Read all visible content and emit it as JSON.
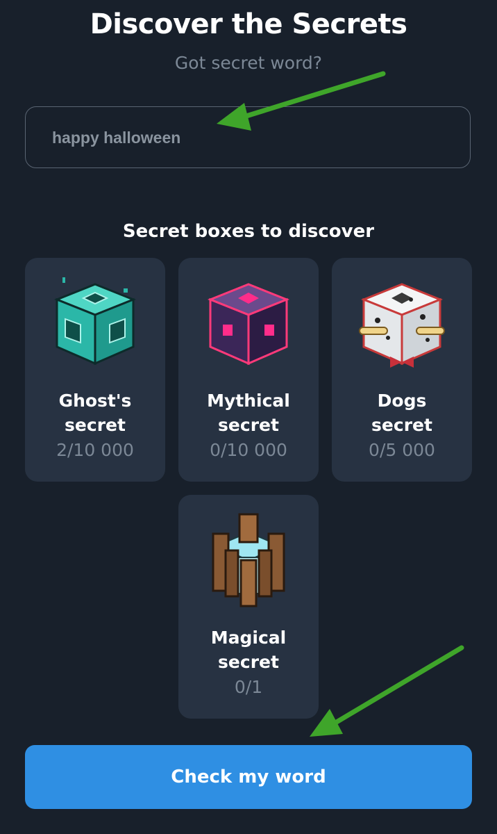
{
  "header": {
    "title": "Discover the Secrets",
    "subtitle": "Got secret word?"
  },
  "secret_input": {
    "value": "happy halloween"
  },
  "section": {
    "title": "Secret boxes to discover"
  },
  "boxes": [
    {
      "name": "Ghost's secret",
      "count": "2/10 000",
      "icon": "ghost-cube-icon",
      "color": "#2bb7a8"
    },
    {
      "name": "Mythical secret",
      "count": "0/10 000",
      "icon": "mythical-cube-icon",
      "color": "#4a2d6b"
    },
    {
      "name": "Dogs secret",
      "count": "0/5 000",
      "icon": "dog-cube-icon",
      "color": "#e9ecef"
    },
    {
      "name": "Magical secret",
      "count": "0/1",
      "icon": "magical-cube-icon",
      "color": "#8a5a34"
    }
  ],
  "action": {
    "label": "Check my word"
  },
  "colors": {
    "background": "#18202b",
    "card": "#273242",
    "button": "#2f8fe3",
    "annotation_arrow": "#3fa52a"
  }
}
